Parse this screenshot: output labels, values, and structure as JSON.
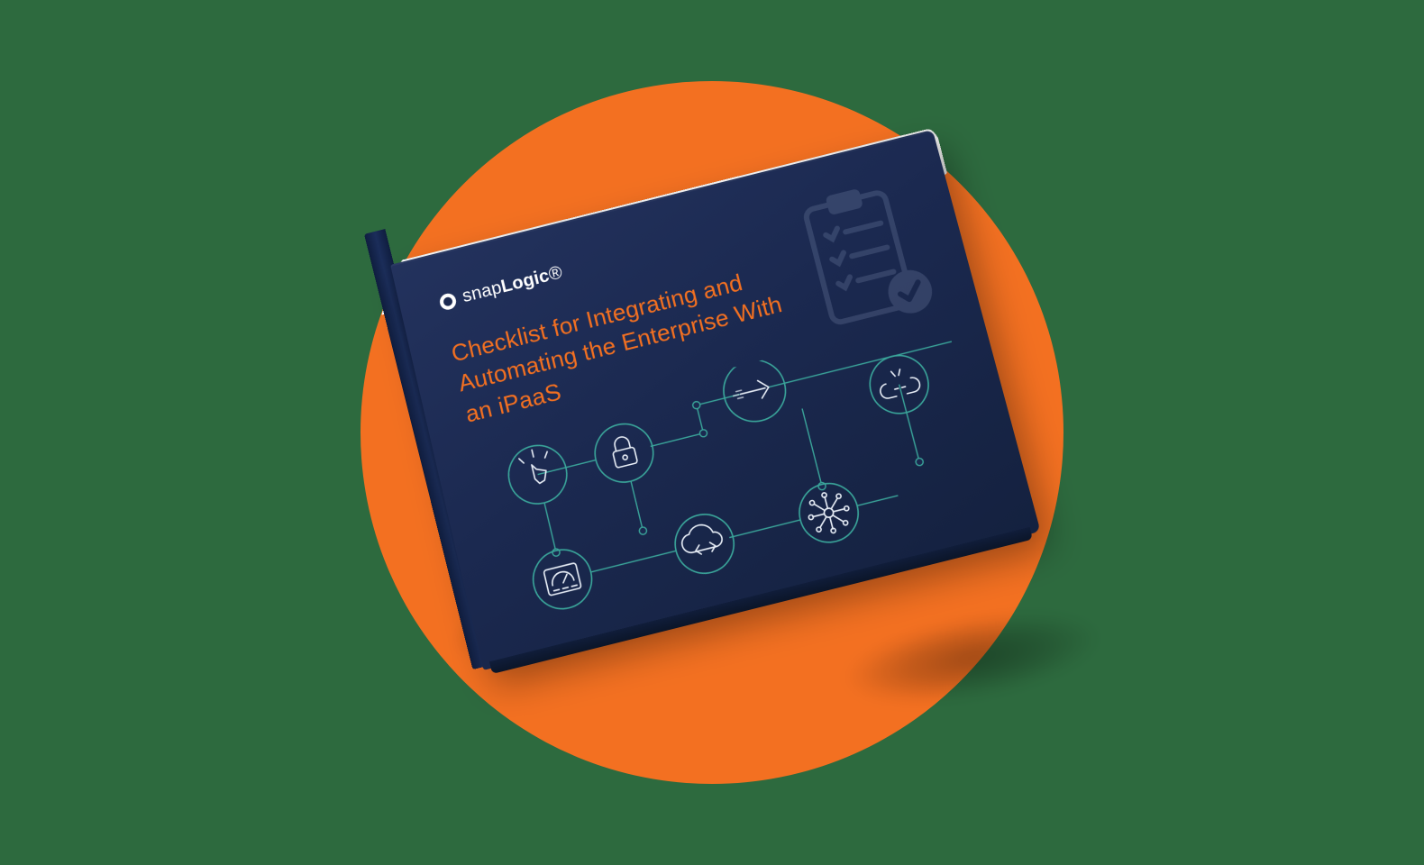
{
  "brand": {
    "name_prefix": "snap",
    "name_suffix": "Logic"
  },
  "cover": {
    "title": "Checklist for Integrating and Automating the Enterprise With an iPaaS"
  },
  "colors": {
    "background": "#2d6a3e",
    "accent_circle": "#f37021",
    "cover_navy": "#1b2950",
    "title_orange": "#f37021",
    "line_teal": "#3aa59a"
  },
  "icons": {
    "clipboard": "clipboard-check-icon",
    "nodes": [
      "hand-click-icon",
      "lock-icon",
      "arrow-right-icon",
      "broken-link-icon",
      "dashboard-gauge-icon",
      "cloud-code-icon",
      "network-hub-icon"
    ]
  }
}
